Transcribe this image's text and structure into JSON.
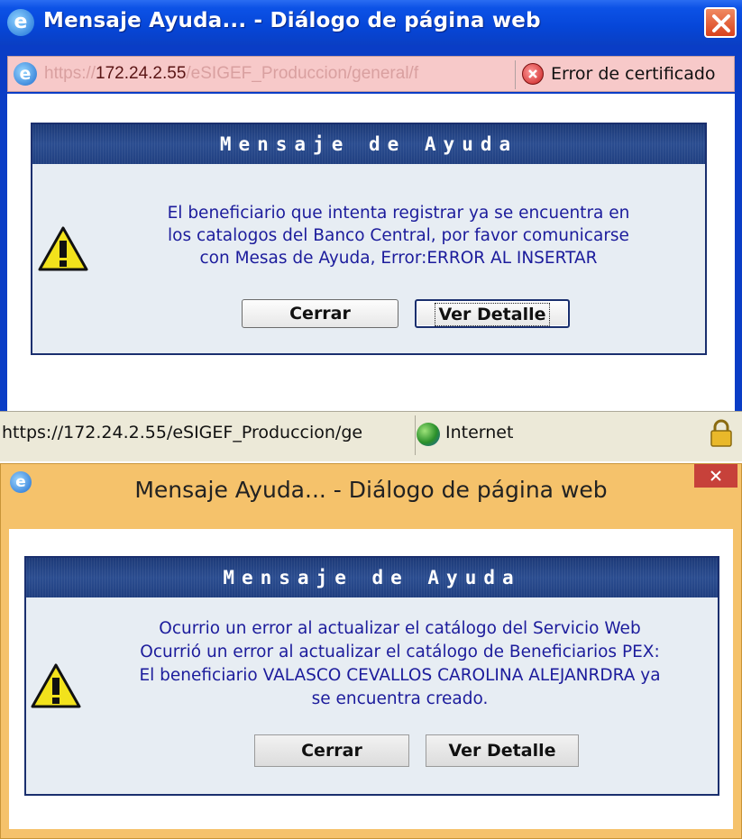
{
  "window1": {
    "title": "Mensaje Ayuda... - Diálogo de página web",
    "address": {
      "protocol": "https://",
      "host": "172.24.2.55",
      "path": "/eSIGEF_Produccion/general/f",
      "certificate_error": "Error de certificado"
    },
    "panel": {
      "header": "Mensaje de Ayuda",
      "message_lines": [
        "El beneficiario que intenta registrar ya se encuentra en",
        "los catalogos del Banco Central, por favor comunicarse",
        "con Mesas de Ayuda, Error:ERROR AL INSERTAR"
      ],
      "close_label": "Cerrar",
      "detail_label": "Ver Detalle"
    },
    "statusbar": {
      "url": "https://172.24.2.55/eSIGEF_Produccion/ge",
      "zone": "Internet"
    }
  },
  "window2": {
    "title": "Mensaje Ayuda... - Diálogo de página web",
    "panel": {
      "header": "Mensaje de Ayuda",
      "message_lines": [
        "Ocurrio un error al actualizar el catálogo del Servicio Web",
        "Ocurrió un error al actualizar el catálogo de Beneficiarios PEX:",
        "El beneficiario VALASCO CEVALLOS CAROLINA ALEJANRDRA ya",
        "se encuentra creado."
      ],
      "close_label": "Cerrar",
      "detail_label": "Ver Detalle"
    }
  },
  "icons": {
    "ie": "ie-icon",
    "close": "close-icon",
    "certificate": "certificate-error-icon",
    "warning": "warning-icon",
    "globe": "globe-icon",
    "lock": "lock-icon"
  },
  "colors": {
    "xp_titlebar": "#0646d8",
    "panel_header": "#203f80",
    "message_text": "#1c1c9c",
    "win8_frame": "#f5c26b",
    "win8_close": "#c7413a"
  }
}
